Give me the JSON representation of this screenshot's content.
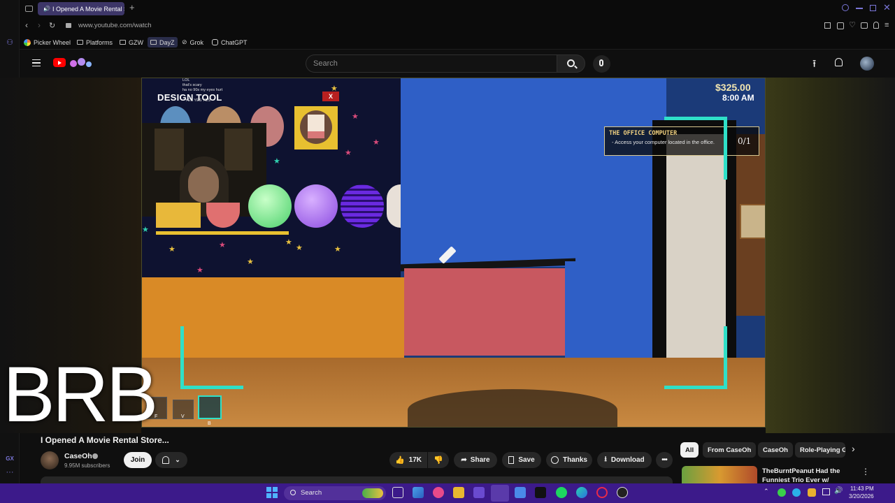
{
  "browser": {
    "tab_title": "I Opened A Movie Rental Store",
    "url": "www.youtube.com/watch",
    "bookmarks": [
      "Picker Wheel",
      "Platforms",
      "GZW",
      "DayZ",
      "Grok",
      "ChatGPT"
    ],
    "accent": "#3d3668"
  },
  "siderail": {
    "label_gx": "GX"
  },
  "youtube": {
    "search_placeholder": "Search"
  },
  "game": {
    "money": "$325.00",
    "time": "8:00 AM",
    "objective_title": "THE OFFICE COMPUTER",
    "objective_desc": "- Access your computer located in the office.",
    "objective_progress": "0/1",
    "design_tool_title": "DESIGN TOOL",
    "design_tool_close": "X",
    "chat_line_1": "LOL",
    "chat_line_2": "that's scary",
    "chat_line_3": "ha no 90s my eyes hurt",
    "chat_line_4": "YES YES YES",
    "hotbar_keys": [
      "F",
      "V",
      "B"
    ]
  },
  "overlay": {
    "brb": "BRB"
  },
  "video": {
    "title": "I Opened A Movie Rental Store...",
    "channel": "CaseOh",
    "subscribers": "9.95M subscribers",
    "join": "Join",
    "likes": "17K",
    "share": "Share",
    "save": "Save",
    "thanks": "Thanks",
    "download": "Download"
  },
  "sidebar": {
    "chips": [
      "All",
      "From CaseOh",
      "CaseOh",
      "Role-Playing G"
    ],
    "rec_title": "TheBurntPeanut Had the Funniest Trio Ever w/ Cloakzy"
  },
  "taskbar": {
    "search_label": "Search",
    "time": "11:43 PM",
    "date": "3/20/2026",
    "accent": "#3c1a8a"
  }
}
